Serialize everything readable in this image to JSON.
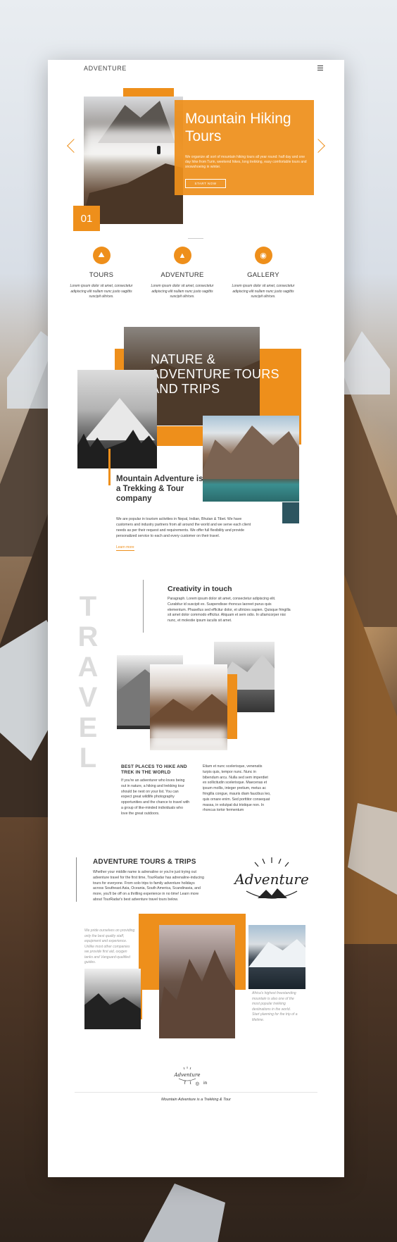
{
  "header": {
    "logo": "ADVENTURE",
    "menu_icon": "hamburger-menu-icon"
  },
  "hero": {
    "title": "Mountain Hiking Tours",
    "text": "We organize all sort of mountain hiking tours all year round: half day and one day hike from Turin, weekend hikes, long trekking, easy comfortable tours and snowshoeing in winter.",
    "button": "START NOW",
    "slide_number": "01",
    "prev_icon": "chevron-left-icon",
    "next_icon": "chevron-right-icon"
  },
  "features": [
    {
      "icon": "hiker-icon",
      "title": "TOURS",
      "text": "Lorem ipsum dolor sit amet, consectetur adipiscing elit nullam nunc justo sagittis suscipit ultrices."
    },
    {
      "icon": "mountain-icon",
      "title": "ADVENTURE",
      "text": "Lorem ipsum dolor sit amet, consectetur adipiscing elit nullam nunc justo sagittis suscipit ultrices."
    },
    {
      "icon": "camera-icon",
      "title": "GALLERY",
      "text": "Lorem ipsum dolor sit amet, consectetur adipiscing elit nullam nunc justo sagittis suscipit ultrices."
    }
  ],
  "nature": {
    "title": "NATURE & ADVENTURE TOURS AND TRIPS",
    "heading": "Mountain Adventure is a Trekking & Tour company",
    "text": "We are popular in tourism activities in Nepal, Indian, Bhutan & Tibet. We have customers and industry partners from all around the world and we serve each client needs as per their request and requirements. We offer full flexibility and provide personalized service to each and every customer on their travel.",
    "link": "Learn more"
  },
  "travel": {
    "word": "TRAVEL",
    "creativity_title": "Creativity in touch",
    "creativity_text": "Paragraph. Lorem ipsum dolor sit amet, consectetur adipiscing elit. Curabitur id suscipit ex. Suspendisse rhoncus laoreet purus quis elementum. Phasellus sed efficitur dolor, et ultricies sapien. Quisque fringilla sit amet dolor commodo efficitur. Aliquam et sem odio. In ullamcorper nisi nunc, et molestie ipsum iaculis sit amet.",
    "best_title": "BEST PLACES TO HIKE AND TREK IN THE WORLD",
    "best_text": "If you're an adventurer who loves being out in nature, a hiking and trekking tour should be next on your list. You can expect great wildlife photography opportunities and the chance to travel with a group of like-minded individuals who love the great outdoors.",
    "side_text": "Etiam et nunc scelerisque, venenatis turpis quis, tempor nunc. Nunc in bibendum arcu. Nulla sed sem imperdiet ex sollicitudin scelerisque. Maecenas et ipsum mollis, integer pretium, metus ac fringilla congue, mauris diam faucibus leo, quis ornare enim. Sed porttitor consequat massa, in volutpat dui tristique non. In rhoncus tortor fermentum"
  },
  "tours": {
    "title": "ADVENTURE TOURS & TRIPS",
    "text": "Whether your middle name is adrenaline or you're just trying out adventure travel for the first time, TourRadar has adrenaline-inducing tours for everyone. From solo trips to family adventure holidays across Southeast Asia, Oceania, South America, Scandinavia, and more, you'll be off on a thrilling experience in no time! Learn more about TourRadar's best adventure travel tours below.",
    "badge_text": "Adventure",
    "quote1": "We pride ourselves on providing only the best quality staff, equipment and experience. Unlike most other companies we provide first aid, oxygen tanks and Vanguard-qualified guides.",
    "quote2": "Africa's highest freestanding mountain is also one of the most popular trekking destinations in the world. Start planning for the trip of a lifetime."
  },
  "footer": {
    "logo_text": "Adventure",
    "social": [
      "f",
      "t",
      "◎",
      "in"
    ],
    "text": "Mountain Adventure is a Trekking & Tour"
  },
  "colors": {
    "accent": "#ee8f1b",
    "text": "#333333",
    "muted": "#999999"
  }
}
